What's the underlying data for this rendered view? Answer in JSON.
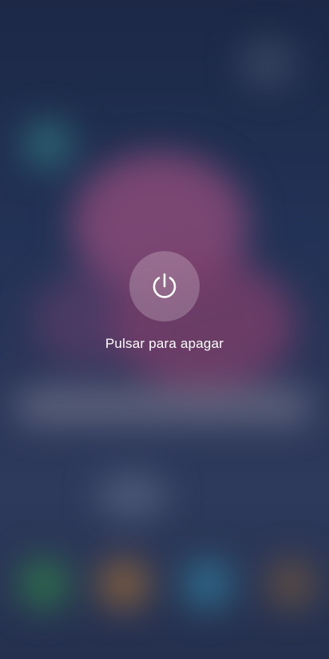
{
  "power_menu": {
    "label": "Pulsar para apagar",
    "icon": "power-icon"
  },
  "colors": {
    "background_top": "#1c2846",
    "background_bottom": "#25304e",
    "button_fill": "rgba(255,255,255,0.22)",
    "text": "#ffffff"
  }
}
